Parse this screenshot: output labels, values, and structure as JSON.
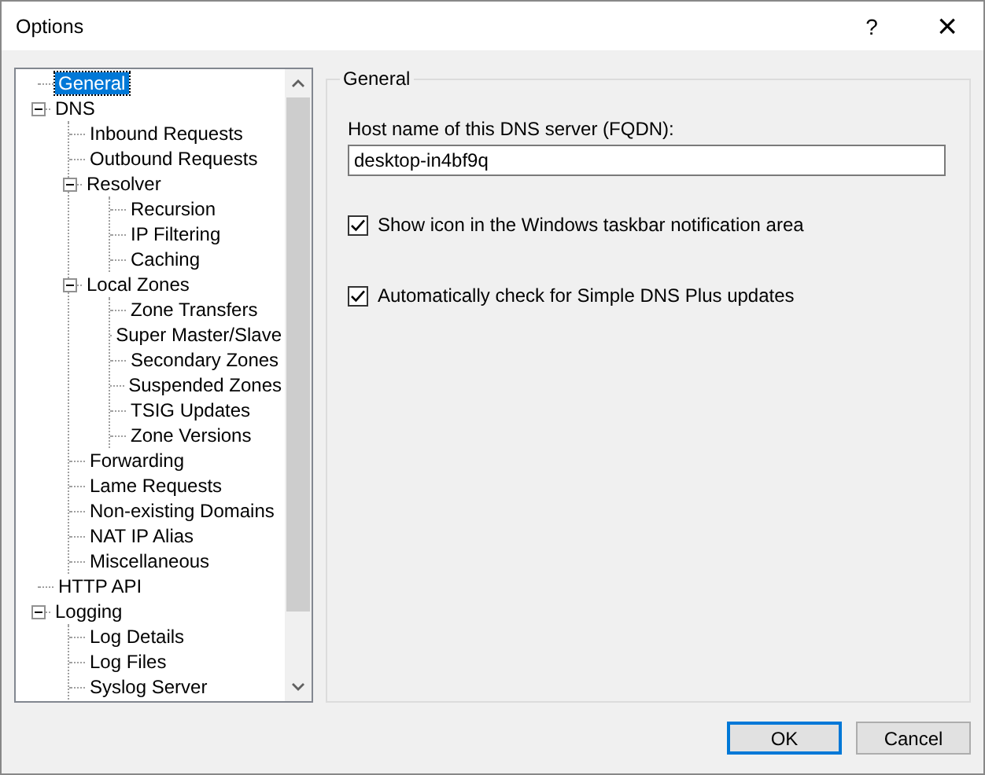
{
  "window": {
    "title": "Options",
    "help_button": "?",
    "close_button": "×"
  },
  "tree": [
    {
      "label": "General",
      "selected": true
    },
    {
      "label": "DNS",
      "selected": false,
      "expanded": true,
      "children": [
        {
          "label": "Inbound Requests",
          "selected": false
        },
        {
          "label": "Outbound Requests",
          "selected": false
        },
        {
          "label": "Resolver",
          "selected": false,
          "expanded": true,
          "children": [
            {
              "label": "Recursion",
              "selected": false
            },
            {
              "label": "IP Filtering",
              "selected": false
            },
            {
              "label": "Caching",
              "selected": false
            }
          ]
        },
        {
          "label": "Local Zones",
          "selected": false,
          "expanded": true,
          "children": [
            {
              "label": "Zone Transfers",
              "selected": false
            },
            {
              "label": "Super Master/Slave",
              "selected": false
            },
            {
              "label": "Secondary Zones",
              "selected": false
            },
            {
              "label": "Suspended Zones",
              "selected": false
            },
            {
              "label": "TSIG Updates",
              "selected": false
            },
            {
              "label": "Zone Versions",
              "selected": false
            }
          ]
        },
        {
          "label": "Forwarding",
          "selected": false
        },
        {
          "label": "Lame Requests",
          "selected": false
        },
        {
          "label": "Non-existing Domains",
          "selected": false
        },
        {
          "label": "NAT IP Alias",
          "selected": false
        },
        {
          "label": "Miscellaneous",
          "selected": false
        }
      ]
    },
    {
      "label": "HTTP API",
      "selected": false
    },
    {
      "label": "Logging",
      "selected": false,
      "expanded": true,
      "children": [
        {
          "label": "Log Details",
          "selected": false
        },
        {
          "label": "Log Files",
          "selected": false
        },
        {
          "label": "Syslog Server",
          "selected": false
        }
      ]
    }
  ],
  "group": {
    "title": "General",
    "host_label": "Host name of this DNS server (FQDN):",
    "host_value": "desktop-in4bf9q",
    "checkboxes": [
      {
        "label": "Show icon in the Windows taskbar notification area",
        "checked": true
      },
      {
        "label": "Automatically check for Simple DNS Plus updates",
        "checked": true
      }
    ]
  },
  "buttons": [
    {
      "label": "OK",
      "default": true
    },
    {
      "label": "Cancel",
      "default": false
    }
  ]
}
